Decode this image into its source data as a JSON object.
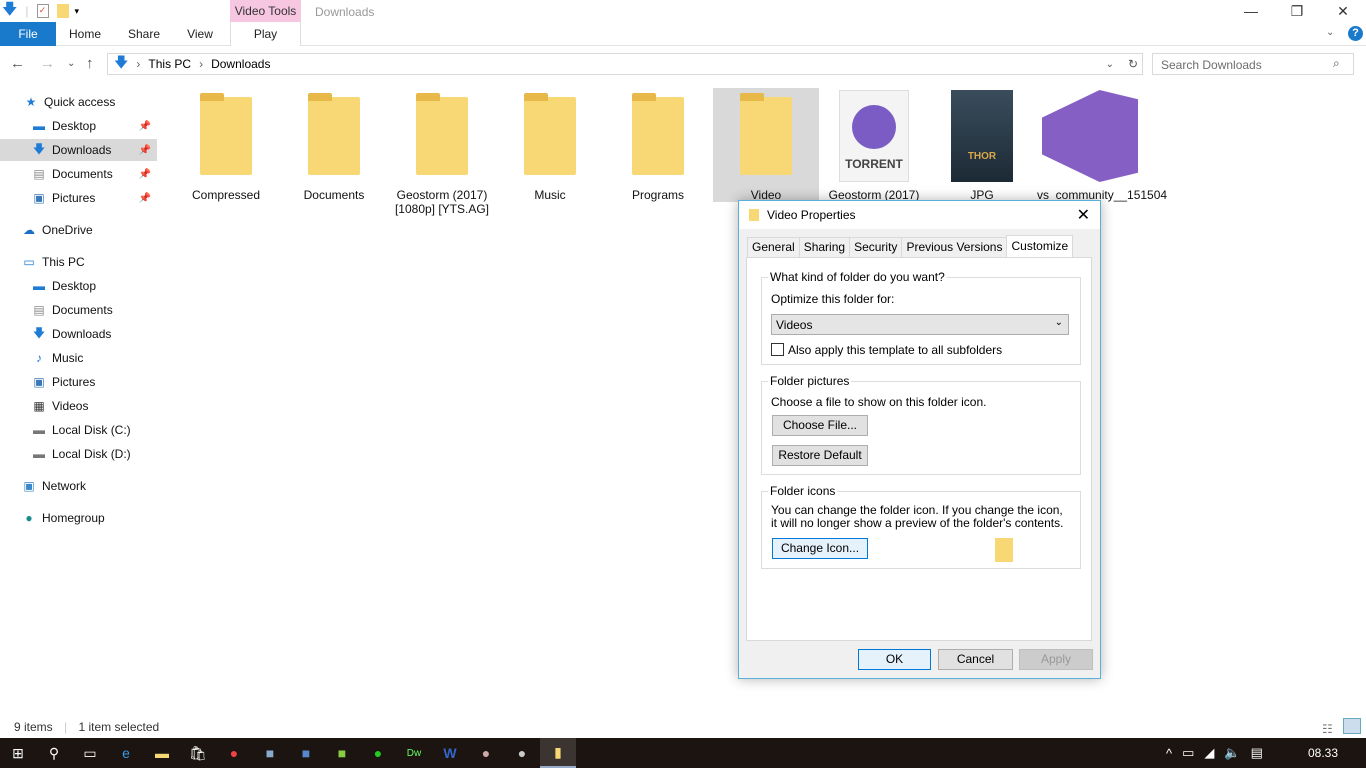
{
  "window": {
    "title": "Downloads",
    "context_tab": "Video Tools",
    "minimize": "—",
    "restore": "❐",
    "close": "✕"
  },
  "ribbon": {
    "tabs": [
      "File",
      "Home",
      "Share",
      "View",
      "Play"
    ]
  },
  "address": {
    "parts": [
      "This PC",
      "Downloads"
    ],
    "search_placeholder": "Search Downloads"
  },
  "sidebar": {
    "items": [
      {
        "label": "Quick access",
        "icon": "star-icon"
      },
      {
        "label": "Desktop",
        "icon": "desktop-icon",
        "pinned": true
      },
      {
        "label": "Downloads",
        "icon": "download-icon",
        "pinned": true,
        "selected": true
      },
      {
        "label": "Documents",
        "icon": "documents-icon",
        "pinned": true
      },
      {
        "label": "Pictures",
        "icon": "pictures-icon",
        "pinned": true
      },
      {
        "label": "OneDrive",
        "icon": "cloud-icon"
      },
      {
        "label": "This PC",
        "icon": "computer-icon"
      },
      {
        "label": "Desktop",
        "icon": "desktop-icon"
      },
      {
        "label": "Documents",
        "icon": "documents-icon"
      },
      {
        "label": "Downloads",
        "icon": "download-icon"
      },
      {
        "label": "Music",
        "icon": "music-icon"
      },
      {
        "label": "Pictures",
        "icon": "pictures-icon"
      },
      {
        "label": "Videos",
        "icon": "video-icon"
      },
      {
        "label": "Local Disk (C:)",
        "icon": "drive-icon"
      },
      {
        "label": "Local Disk (D:)",
        "icon": "drive-icon"
      },
      {
        "label": "Network",
        "icon": "network-icon"
      },
      {
        "label": "Homegroup",
        "icon": "homegroup-icon"
      }
    ]
  },
  "files": [
    {
      "name": "Compressed",
      "type": "folder"
    },
    {
      "name": "Documents",
      "type": "folder"
    },
    {
      "name": "Geostorm (2017) [1080p] [YTS.AG]",
      "type": "folder"
    },
    {
      "name": "Music",
      "type": "folder"
    },
    {
      "name": "Programs",
      "type": "folder"
    },
    {
      "name": "Video",
      "type": "folder",
      "selected": true
    },
    {
      "name": "Geostorm (2017)",
      "type": "torrent",
      "badge": "TORRENT"
    },
    {
      "name": "JPG",
      "type": "image",
      "poster_text": "THOR"
    },
    {
      "name": "vs_community__151504",
      "type": "installer"
    }
  ],
  "status": {
    "count": "9 items",
    "selected": "1 item selected"
  },
  "dialog": {
    "title": "Video Properties",
    "tabs": [
      "General",
      "Sharing",
      "Security",
      "Previous Versions",
      "Customize"
    ],
    "group1": {
      "label": "What kind of folder do you want?",
      "optimize_label": "Optimize this folder for:",
      "optimize_value": "Videos",
      "checkbox_label": "Also apply this template to all subfolders",
      "checked": false
    },
    "group2": {
      "label": "Folder pictures",
      "desc": "Choose a file to show on this folder icon.",
      "choose": "Choose File...",
      "restore": "Restore Default"
    },
    "group3": {
      "label": "Folder icons",
      "desc": "You can change the folder icon. If you change the icon, it will no longer show a preview of the folder's contents.",
      "change": "Change Icon..."
    },
    "ok": "OK",
    "cancel": "Cancel",
    "apply": "Apply"
  },
  "taskbar": {
    "time": "08.33"
  }
}
